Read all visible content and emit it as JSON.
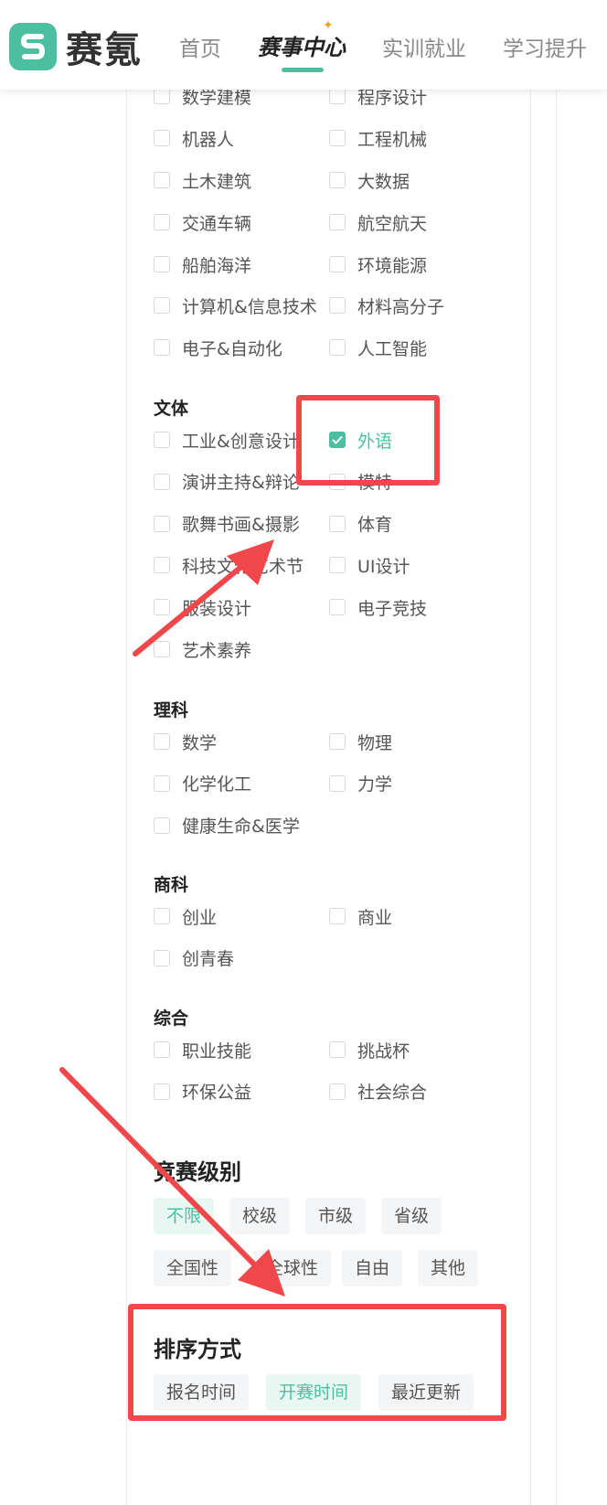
{
  "header": {
    "logo_text": "赛氪",
    "nav": [
      "首页",
      "赛事中心",
      "实训就业",
      "学习提升"
    ]
  },
  "categories": {
    "top_items": [
      [
        "数学建模",
        "程序设计"
      ],
      [
        "机器人",
        "工程机械"
      ],
      [
        "土木建筑",
        "大数据"
      ],
      [
        "交通车辆",
        "航空航天"
      ],
      [
        "船舶海洋",
        "环境能源"
      ],
      [
        "计算机&信息技术",
        "材料高分子"
      ],
      [
        "电子&自动化",
        "人工智能"
      ]
    ],
    "groups": [
      {
        "title": "文体",
        "items": [
          [
            "工业&创意设计",
            "外语"
          ],
          [
            "演讲主持&辩论",
            "模特"
          ],
          [
            "歌舞书画&摄影",
            "体育"
          ],
          [
            "科技文化艺术节",
            "UI设计"
          ],
          [
            "服装设计",
            "电子竞技"
          ],
          [
            "艺术素养"
          ]
        ]
      },
      {
        "title": "理科",
        "items": [
          [
            "数学",
            "物理"
          ],
          [
            "化学化工",
            "力学"
          ],
          [
            "健康生命&医学"
          ]
        ]
      },
      {
        "title": "商科",
        "items": [
          [
            "创业",
            "商业"
          ],
          [
            "创青春"
          ]
        ]
      },
      {
        "title": "综合",
        "items": [
          [
            "职业技能",
            "挑战杯"
          ],
          [
            "环保公益",
            "社会综合"
          ]
        ]
      }
    ],
    "checked": "外语"
  },
  "level": {
    "title": "竞赛级别",
    "tags": [
      "不限",
      "校级",
      "市级",
      "省级",
      "全国性",
      "全球性",
      "自由",
      "其他"
    ],
    "active": "不限"
  },
  "sort": {
    "title": "排序方式",
    "tags": [
      "报名时间",
      "开赛时间",
      "最近更新"
    ],
    "active": "开赛时间"
  },
  "colors": {
    "accent": "#4bbfa0",
    "annotation": "#f0474a"
  }
}
